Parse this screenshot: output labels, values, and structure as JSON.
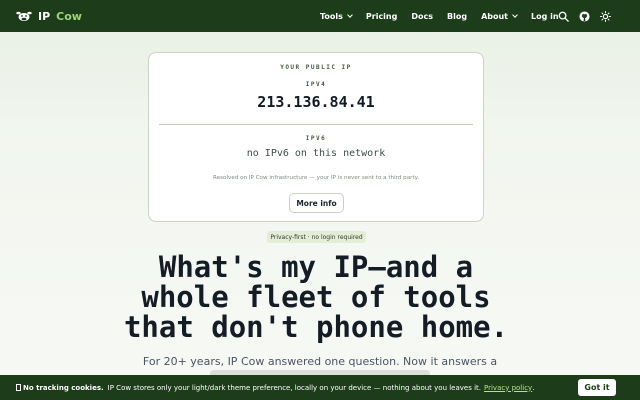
{
  "nav": {
    "brand_ip": "IP",
    "brand_cow": "Cow",
    "links": [
      {
        "label": "Tools",
        "dropdown": true
      },
      {
        "label": "Pricing",
        "dropdown": false
      },
      {
        "label": "Docs",
        "dropdown": false
      },
      {
        "label": "Blog",
        "dropdown": false
      },
      {
        "label": "About",
        "dropdown": true
      },
      {
        "label": "Log in",
        "dropdown": false
      }
    ],
    "icons": [
      "search-icon",
      "github-icon",
      "sun-icon"
    ]
  },
  "ip_card": {
    "title": "YOUR PUBLIC IP",
    "ipv4_label": "IPV4",
    "ipv4_value": "213.136.84.41",
    "ipv6_label": "IPV6",
    "ipv6_value": "no IPv6 on this network",
    "note": "Resolved on IP Cow infrastructure — your IP is never sent to a third party.",
    "more_info_label": "More info"
  },
  "badge": "Privacy-first · no login required",
  "hero": {
    "headline_lines": [
      "What's my IP—and a",
      "whole fleet of tools",
      "that don't phone home."
    ],
    "subline": "For 20+ years, IP Cow answered one question. Now it answers a"
  },
  "cookie": {
    "glyph": "cookie-icon",
    "strong": "No tracking cookies.",
    "text": "IP Cow stores only your light/dark theme preference, locally on your device — nothing about you leaves it.",
    "link": "Privacy policy",
    "link_suffix": ".",
    "button": "Got it"
  },
  "colors": {
    "nav_bg": "#1d3d1a",
    "accent_green": "#9fd37a",
    "badge_bg": "#e5edd9"
  }
}
